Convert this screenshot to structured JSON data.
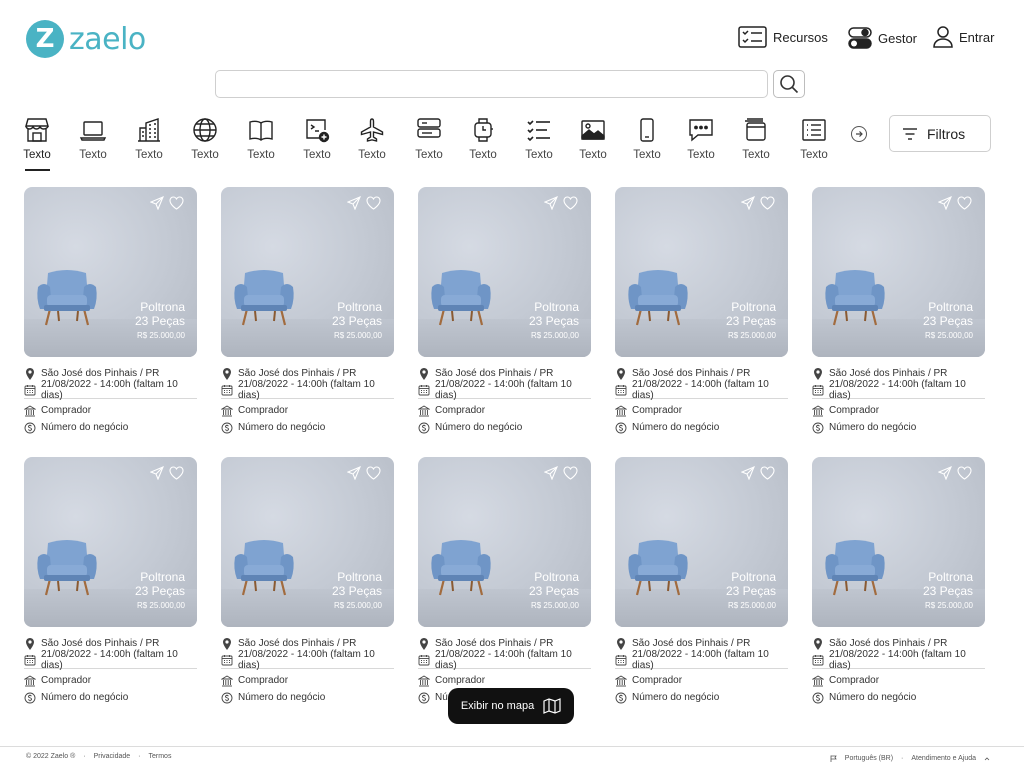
{
  "brand": {
    "logo_letter": "Z",
    "name": "zaelo",
    "color": "#4ab3c4"
  },
  "header": {
    "links": [
      {
        "label": "Recursos",
        "icon": "checklist-icon"
      },
      {
        "label": "Gestor",
        "icon": "toggle-icon"
      },
      {
        "label": "Entrar",
        "icon": "user-icon"
      }
    ]
  },
  "search": {
    "value": "",
    "placeholder": ""
  },
  "categories": [
    {
      "label": "Texto",
      "icon": "store-icon",
      "active": true
    },
    {
      "label": "Texto",
      "icon": "laptop-icon"
    },
    {
      "label": "Texto",
      "icon": "building-icon"
    },
    {
      "label": "Texto",
      "icon": "globe-icon"
    },
    {
      "label": "Texto",
      "icon": "book-icon"
    },
    {
      "label": "Texto",
      "icon": "terminal-add-icon"
    },
    {
      "label": "Texto",
      "icon": "airplane-icon"
    },
    {
      "label": "Texto",
      "icon": "server-icon"
    },
    {
      "label": "Texto",
      "icon": "watch-icon"
    },
    {
      "label": "Texto",
      "icon": "task-list-icon"
    },
    {
      "label": "Texto",
      "icon": "image-icon"
    },
    {
      "label": "Texto",
      "icon": "phone-icon"
    },
    {
      "label": "Texto",
      "icon": "chat-icon"
    },
    {
      "label": "Texto",
      "icon": "window-icon"
    },
    {
      "label": "Texto",
      "icon": "list-icon"
    }
  ],
  "filters": {
    "label": "Filtros"
  },
  "listings": [
    {
      "title_line1": "Poltrona",
      "title_line2": "23 Peças",
      "price": "R$ 25.000,00",
      "location": "São José dos Pinhais / PR",
      "date": "21/08/2022 - 14:00h (faltam 10 dias)",
      "buyer": "Comprador",
      "deal": "Número do negócio"
    },
    {
      "title_line1": "Poltrona",
      "title_line2": "23 Peças",
      "price": "R$ 25.000,00",
      "location": "São José dos Pinhais / PR",
      "date": "21/08/2022 - 14:00h (faltam 10 dias)",
      "buyer": "Comprador",
      "deal": "Número do negócio"
    },
    {
      "title_line1": "Poltrona",
      "title_line2": "23 Peças",
      "price": "R$ 25.000,00",
      "location": "São José dos Pinhais / PR",
      "date": "21/08/2022 - 14:00h (faltam 10 dias)",
      "buyer": "Comprador",
      "deal": "Número do negócio"
    },
    {
      "title_line1": "Poltrona",
      "title_line2": "23 Peças",
      "price": "R$ 25.000,00",
      "location": "São José dos Pinhais / PR",
      "date": "21/08/2022 - 14:00h (faltam 10 dias)",
      "buyer": "Comprador",
      "deal": "Número do negócio"
    },
    {
      "title_line1": "Poltrona",
      "title_line2": "23 Peças",
      "price": "R$ 25.000,00",
      "location": "São José dos Pinhais / PR",
      "date": "21/08/2022 - 14:00h (faltam 10 dias)",
      "buyer": "Comprador",
      "deal": "Número do negócio"
    },
    {
      "title_line1": "Poltrona",
      "title_line2": "23 Peças",
      "price": "R$ 25.000,00",
      "location": "São José dos Pinhais / PR",
      "date": "21/08/2022 - 14:00h (faltam 10 dias)",
      "buyer": "Comprador",
      "deal": "Número do negócio"
    },
    {
      "title_line1": "Poltrona",
      "title_line2": "23 Peças",
      "price": "R$ 25.000,00",
      "location": "São José dos Pinhais / PR",
      "date": "21/08/2022 - 14:00h (faltam 10 dias)",
      "buyer": "Comprador",
      "deal": "Número do negócio"
    },
    {
      "title_line1": "Poltrona",
      "title_line2": "23 Peças",
      "price": "R$ 25.000,00",
      "location": "São José dos Pinhais / PR",
      "date": "21/08/2022 - 14:00h (faltam 10 dias)",
      "buyer": "Comprador",
      "deal": "Número do negócio"
    },
    {
      "title_line1": "Poltrona",
      "title_line2": "23 Peças",
      "price": "R$ 25.000,00",
      "location": "São José dos Pinhais / PR",
      "date": "21/08/2022 - 14:00h (faltam 10 dias)",
      "buyer": "Comprador",
      "deal": "Número do negócio"
    },
    {
      "title_line1": "Poltrona",
      "title_line2": "23 Peças",
      "price": "R$ 25.000,00",
      "location": "São José dos Pinhais / PR",
      "date": "21/08/2022 - 14:00h (faltam 10 dias)",
      "buyer": "Comprador",
      "deal": "Número do negócio"
    }
  ],
  "map_button": {
    "label": "Exibir no mapa",
    "icon": "map-icon"
  },
  "footer": {
    "copyright": "© 2022 Zaelo ®",
    "sep": "·",
    "privacy": "Privacidade",
    "terms": "Termos",
    "language": "Português (BR)",
    "help": "Atendimento e Ajuda"
  }
}
